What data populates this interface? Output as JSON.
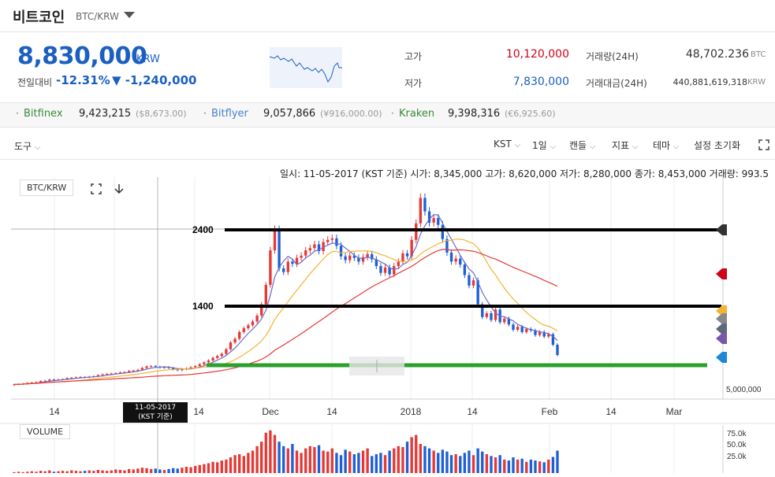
{
  "header": {
    "coin_name": "비트코인",
    "pair": "BTC/KRW"
  },
  "summary": {
    "price": "8,830,000",
    "price_unit": "KRW",
    "change_label": "전일대비",
    "change_pct": "-12.31%",
    "change_amt": "▼ -1,240,000"
  },
  "stats": {
    "high_label": "고가",
    "high_value": "10,120,000",
    "low_label": "저가",
    "low_value": "7,830,000",
    "volume_label": "거래량(24H)",
    "volume_value": "48,702.236",
    "volume_unit": "BTC",
    "amount_label": "거래대금(24H)",
    "amount_value": "440,881,619,318",
    "amount_unit": "KRW"
  },
  "exchanges": [
    {
      "name": "Bitfinex",
      "price": "9,423,215",
      "sub": "($8,673.00)"
    },
    {
      "name": "Bitflyer",
      "price": "9,057,866",
      "sub": "(¥916,000.00)"
    },
    {
      "name": "Kraken",
      "price": "9,398,316",
      "sub": "(€6,925.60)"
    }
  ],
  "toolbar": {
    "tools": "도구",
    "timezone": "KST",
    "interval": "1일",
    "candle": "캔들",
    "indicator": "지표",
    "theme": "테마",
    "reset": "설정 초기화"
  },
  "ohlc_line": "일시: 11-05-2017 (KST 기준) 시가: 8,345,000 고가: 8,620,000 저가: 8,280,000 종가: 8,453,000 거래량: 993.5",
  "chart_panel": {
    "symbol": "BTC/KRW",
    "volume_label": "VOLUME",
    "date_flag_line1": "11-05-2017",
    "date_flag_line2": "(KST 기준)"
  },
  "colors": {
    "up": "#e53935",
    "down": "#1e5fd6",
    "accent_blue": "#1b5fc1",
    "high_red": "#d0021b"
  },
  "icons": [
    "dropdown-icon",
    "fullscreen-icon",
    "download-icon",
    "expand-icon"
  ],
  "chart_data": {
    "type": "candlestick",
    "x_tick_labels": [
      "14",
      "Dec",
      "14",
      "2018",
      "14",
      "Feb",
      "14",
      "Mar"
    ],
    "y_tick_labels": [
      "5,000,000"
    ],
    "volume_tick_labels": [
      "75.0k",
      "50.0k",
      "25.0k"
    ],
    "annotations": [
      {
        "type": "hline",
        "label": "2400",
        "color": "#000000"
      },
      {
        "type": "hline",
        "label": "1400",
        "color": "#000000"
      },
      {
        "type": "hline",
        "label": "",
        "color": "#2ca02c"
      }
    ],
    "closes": [
      4.9,
      4.95,
      5.0,
      5.1,
      5.15,
      5.2,
      5.35,
      5.4,
      5.55,
      5.5,
      5.55,
      5.6,
      5.75,
      5.8,
      5.85,
      5.9,
      5.85,
      5.95,
      6.0,
      6.15,
      6.25,
      6.3,
      6.35,
      6.4,
      6.5,
      6.55,
      6.7,
      6.75,
      6.85,
      7.1,
      7.3,
      7.35,
      7.25,
      7.15,
      7.2,
      7.1,
      6.9,
      6.8,
      6.95,
      7.05,
      7.2,
      7.35,
      7.6,
      7.85,
      8.1,
      8.45,
      8.7,
      9.0,
      9.6,
      10.5,
      11.0,
      11.9,
      12.4,
      12.8,
      13.3,
      14.1,
      15.6,
      18.2,
      22.8,
      25.6,
      20.4,
      19.9,
      21.3,
      21.0,
      21.8,
      22.1,
      22.8,
      23.1,
      23.6,
      22.7,
      23.9,
      24.2,
      24.4,
      23.4,
      22.0,
      21.5,
      22.1,
      21.8,
      21.3,
      21.9,
      22.3,
      21.6,
      20.7,
      19.8,
      20.5,
      19.6,
      20.7,
      21.3,
      22.4,
      22.0,
      24.2,
      26.4,
      29.8,
      28.0,
      26.5,
      27.1,
      26.2,
      24.3,
      22.5,
      21.3,
      21.7,
      20.9,
      19.5,
      18.1,
      18.8,
      15.6,
      13.9,
      14.4,
      13.5,
      14.9,
      13.2,
      13.7,
      12.9,
      12.2,
      12.6,
      11.9,
      12.3,
      12.1,
      11.5,
      11.9,
      11.3,
      11.6,
      10.2,
      8.83
    ],
    "volumes": [
      2,
      3,
      2,
      3,
      4,
      3,
      5,
      4,
      6,
      3,
      4,
      5,
      4,
      6,
      5,
      4,
      5,
      6,
      5,
      7,
      6,
      5,
      6,
      8,
      7,
      6,
      9,
      8,
      10,
      12,
      11,
      9,
      10,
      8,
      7,
      9,
      11,
      10,
      12,
      14,
      13,
      16,
      18,
      20,
      22,
      25,
      24,
      28,
      30,
      35,
      40,
      42,
      38,
      45,
      50,
      60,
      70,
      90,
      95,
      85,
      70,
      60,
      55,
      65,
      50,
      45,
      55,
      60,
      58,
      62,
      50,
      48,
      55,
      45,
      40,
      52,
      48,
      42,
      45,
      50,
      55,
      38,
      42,
      45,
      40,
      50,
      55,
      60,
      58,
      70,
      80,
      85,
      65,
      60,
      55,
      50,
      45,
      52,
      48,
      40,
      42,
      38,
      45,
      50,
      40,
      55,
      48,
      42,
      38,
      35,
      40,
      30,
      28,
      35,
      30,
      32,
      25,
      30,
      28,
      26,
      24,
      30,
      36,
      50
    ],
    "ma_short_color": "#6c6cc8",
    "ma_mid_color": "#f2b531",
    "ma_long_color": "#e53935"
  }
}
